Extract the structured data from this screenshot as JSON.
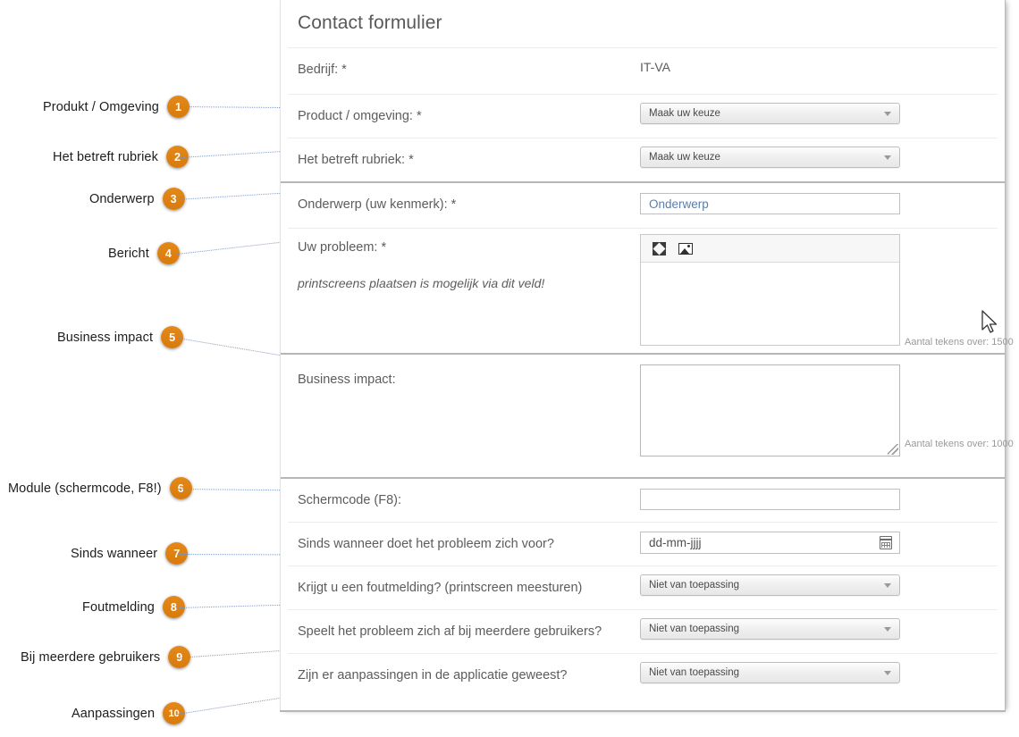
{
  "form": {
    "title": "Contact formulier",
    "rows": [
      {
        "id": "bedrijf",
        "label": "Bedrijf: *",
        "control": "static",
        "value": "IT-VA"
      },
      {
        "id": "product",
        "label": "Product / omgeving: *",
        "control": "select",
        "value": "Maak uw keuze"
      },
      {
        "id": "rubriek",
        "label": "Het betreft rubriek: *",
        "control": "select",
        "value": "Maak uw keuze"
      },
      {
        "id": "onderwerp",
        "label": "Onderwerp (uw kenmerk): *",
        "control": "text",
        "value": "Onderwerp"
      },
      {
        "id": "probleem",
        "label": "Uw probleem: *",
        "control": "editor",
        "note": "printscreens plaatsen is mogelijk via dit veld!",
        "counter": "Aantal tekens over: 1500"
      },
      {
        "id": "impact",
        "label": "Business impact:",
        "control": "textarea",
        "counter": "Aantal tekens over: 1000"
      },
      {
        "id": "schermcode",
        "label": "Schermcode (F8):",
        "control": "text",
        "value": ""
      },
      {
        "id": "sinds",
        "label": "Sinds wanneer doet het probleem zich voor?",
        "control": "date",
        "value": "dd-mm-jjjj"
      },
      {
        "id": "foutmelding",
        "label": "Krijgt u een foutmelding? (printscreen meesturen)",
        "control": "select",
        "value": "Niet van toepassing"
      },
      {
        "id": "gebruikers",
        "label": "Speelt het probleem zich af bij meerdere gebruikers?",
        "control": "select",
        "value": "Niet van toepassing"
      },
      {
        "id": "aanpassingen",
        "label": "Zijn er aanpassingen in de applicatie geweest?",
        "control": "select",
        "value": "Niet van toepassing"
      }
    ]
  },
  "callouts": [
    {
      "number": "1",
      "label": "Produkt / Omgeving"
    },
    {
      "number": "2",
      "label": "Het betreft rubriek"
    },
    {
      "number": "3",
      "label": "Onderwerp"
    },
    {
      "number": "4",
      "label": "Bericht"
    },
    {
      "number": "5",
      "label": "Business impact"
    },
    {
      "number": "6",
      "label": "Module (schermcode, F8!)"
    },
    {
      "number": "7",
      "label": "Sinds wanneer"
    },
    {
      "number": "8",
      "label": "Foutmelding"
    },
    {
      "number": "9",
      "label": "Bij meerdere gebruikers"
    },
    {
      "number": "10",
      "label": "Aanpassingen"
    }
  ],
  "colors": {
    "badge": "#e08214",
    "leader": "#7a90b8",
    "label": "#5b5c5e",
    "placeholder": "#5d7ea8"
  }
}
